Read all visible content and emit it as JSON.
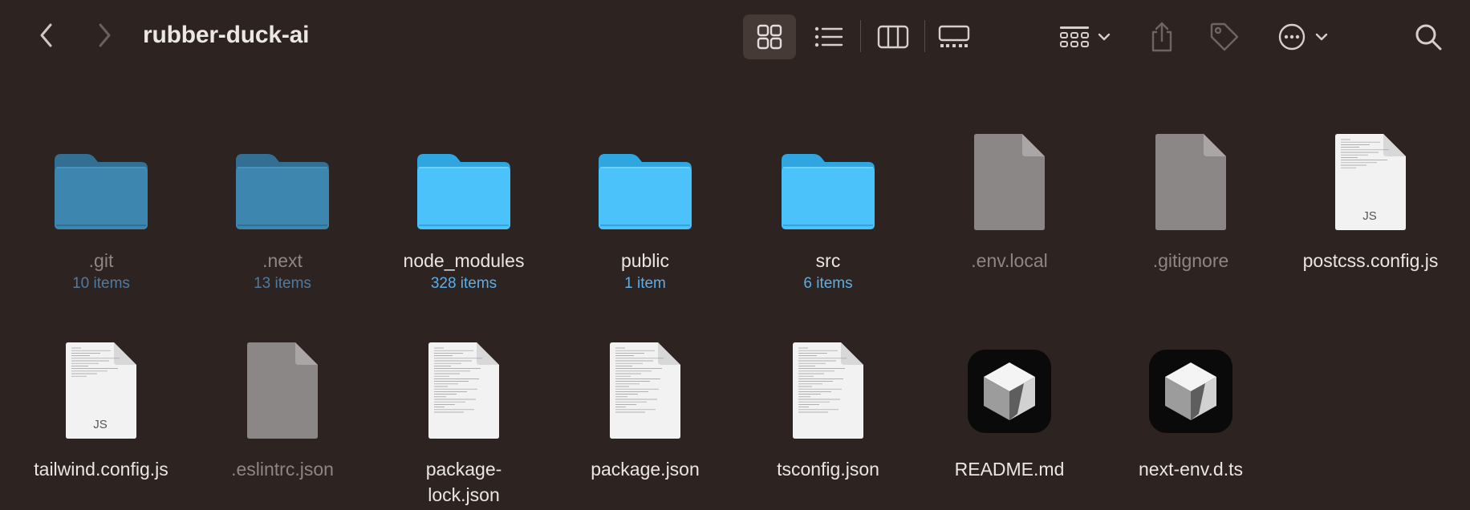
{
  "window": {
    "title": "rubber-duck-ai"
  },
  "toolbar": {
    "back_icon": "chevron-left-icon",
    "forward_icon": "chevron-right-icon",
    "views": [
      "icon-view",
      "list-view",
      "column-view",
      "gallery-view"
    ],
    "active_view": "icon-view",
    "group_icon": "group-grid-icon",
    "share_icon": "share-icon",
    "tag_icon": "tag-icon",
    "more_icon": "ellipsis-circle-icon",
    "search_icon": "search-icon"
  },
  "colors": {
    "background": "#2d2320",
    "folder_blue": "#4cc2fb",
    "folder_dim": "#3d86b0",
    "count_blue": "#5aaeea"
  },
  "files": [
    {
      "name": ".git",
      "count": "10 items",
      "kind": "folder",
      "hidden": true
    },
    {
      "name": ".next",
      "count": "13 items",
      "kind": "folder",
      "hidden": true
    },
    {
      "name": "node_modules",
      "count": "328 items",
      "kind": "folder",
      "hidden": false
    },
    {
      "name": "public",
      "count": "1 item",
      "kind": "folder",
      "hidden": false
    },
    {
      "name": "src",
      "count": "6 items",
      "kind": "folder",
      "hidden": false
    },
    {
      "name": ".env.local",
      "kind": "doc-blank",
      "hidden": true
    },
    {
      "name": ".gitignore",
      "kind": "doc-blank",
      "hidden": true
    },
    {
      "name": "postcss.config.js",
      "kind": "doc-js",
      "badge": "JS",
      "hidden": false
    },
    {
      "name": "tailwind.config.js",
      "kind": "doc-js",
      "badge": "JS",
      "hidden": false
    },
    {
      "name": ".eslintrc.json",
      "kind": "doc-blank",
      "hidden": true
    },
    {
      "name": "package-lock.json",
      "kind": "doc-text",
      "hidden": false
    },
    {
      "name": "package.json",
      "kind": "doc-text",
      "hidden": false
    },
    {
      "name": "tsconfig.json",
      "kind": "doc-text",
      "hidden": false
    },
    {
      "name": "README.md",
      "kind": "app-cube",
      "hidden": false
    },
    {
      "name": "next-env.d.ts",
      "kind": "app-cube",
      "hidden": false
    }
  ]
}
